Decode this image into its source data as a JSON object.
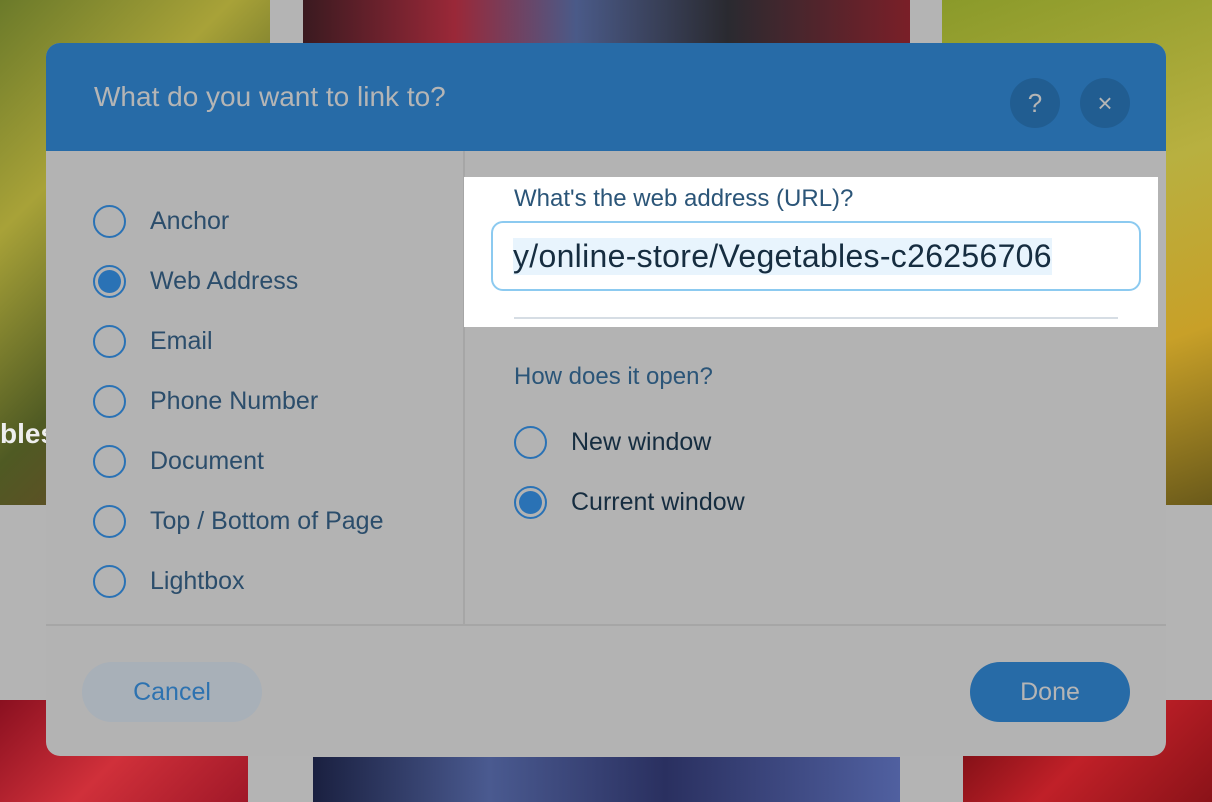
{
  "background": {
    "tile_caption_fragment": "bles"
  },
  "dialog": {
    "title": "What do you want to link to?",
    "help_label": "?",
    "close_label": "×",
    "link_types": [
      {
        "label": "Anchor",
        "selected": false
      },
      {
        "label": "Web Address",
        "selected": true
      },
      {
        "label": "Email",
        "selected": false
      },
      {
        "label": "Phone Number",
        "selected": false
      },
      {
        "label": "Document",
        "selected": false
      },
      {
        "label": "Top / Bottom of Page",
        "selected": false
      },
      {
        "label": "Lightbox",
        "selected": false
      }
    ],
    "url_label": "What's the web address (URL)?",
    "url_value": "y/online-store/Vegetables-c26256706",
    "open_label": "How does it open?",
    "open_options": [
      {
        "label": "New window",
        "selected": false
      },
      {
        "label": "Current window",
        "selected": true
      }
    ],
    "cancel_label": "Cancel",
    "done_label": "Done",
    "colors": {
      "header": "#276ba7",
      "accent": "#2a72b5",
      "body": "#b3b3b3"
    }
  }
}
